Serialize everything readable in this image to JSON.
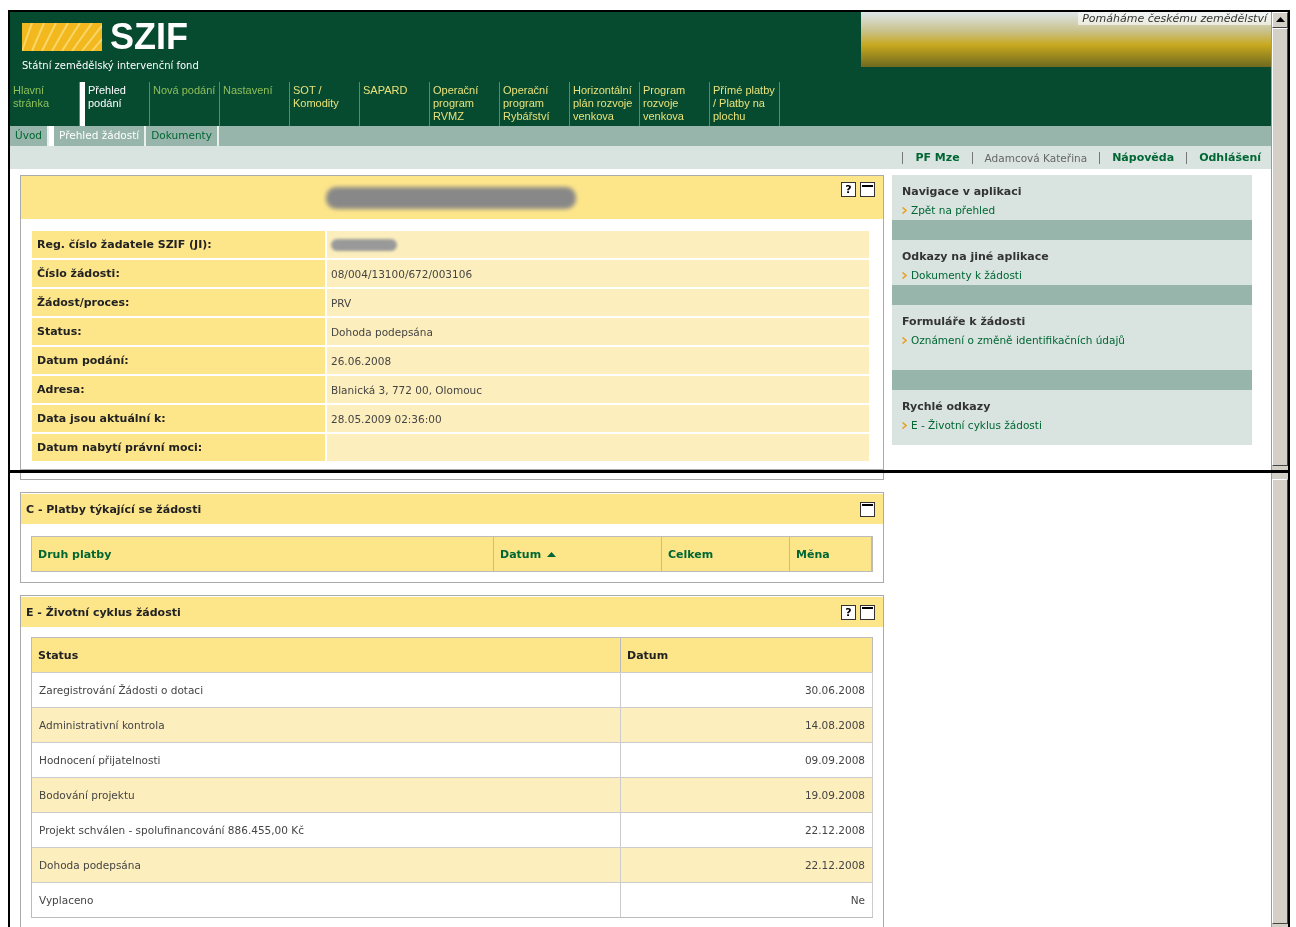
{
  "header": {
    "logo_text": "SZIF",
    "logo_subtitle": "Státní zemědělský intervenční fond",
    "banner_slogan": "Pomáháme českému zemědělství"
  },
  "main_nav": [
    {
      "label": "Hlavní stránka",
      "selected": false,
      "color": "#8fbf5a"
    },
    {
      "label": "Přehled podání",
      "selected": true,
      "color": "#ffffff"
    },
    {
      "label": "Nová podání",
      "selected": false,
      "color": "#8fbf5a"
    },
    {
      "label": "Nastavení",
      "selected": false,
      "color": "#8fbf5a"
    },
    {
      "label": "SOT / Komodity",
      "selected": false,
      "color": "#e8e27a"
    },
    {
      "label": "SAPARD",
      "selected": false,
      "color": "#e8e27a"
    },
    {
      "label": "Operační program RVMZ",
      "selected": false,
      "color": "#e8e27a"
    },
    {
      "label": "Operační program Rybářství",
      "selected": false,
      "color": "#e8e27a"
    },
    {
      "label": "Horizontální plán rozvoje venkova",
      "selected": false,
      "color": "#e8e27a"
    },
    {
      "label": "Program rozvoje venkova",
      "selected": false,
      "color": "#e8e27a"
    },
    {
      "label": "Přímé platby / Platby na plochu",
      "selected": false,
      "color": "#e8e27a"
    }
  ],
  "sub_nav": [
    {
      "label": "Úvod",
      "selected": false
    },
    {
      "label": "Přehled žádostí",
      "selected": true
    },
    {
      "label": "Dokumenty",
      "selected": false
    }
  ],
  "user_bar": [
    {
      "label": "PF Mze",
      "kind": "link"
    },
    {
      "label": "Adamcová Kateřina",
      "kind": "text"
    },
    {
      "label": "Nápověda",
      "kind": "link"
    },
    {
      "label": "Odhlášení",
      "kind": "link"
    }
  ],
  "detail_panel": {
    "help_button": "?",
    "rows": [
      {
        "label": "Reg. číslo žadatele SZIF (JI):",
        "value": null,
        "redacted": true
      },
      {
        "label": "Číslo žádosti:",
        "value": "08/004/13100/672/003106",
        "redacted": false
      },
      {
        "label": "Žádost/proces:",
        "value": "PRV",
        "redacted": false
      },
      {
        "label": "Status:",
        "value": "Dohoda podepsána",
        "redacted": false
      },
      {
        "label": "Datum podání:",
        "value": "26.06.2008",
        "redacted": false
      },
      {
        "label": "Adresa:",
        "value": "Blanická 3, 772 00, Olomouc",
        "redacted": false
      },
      {
        "label": "Data jsou aktuální k:",
        "value": "28.05.2009 02:36:00",
        "redacted": false
      },
      {
        "label": "Datum nabytí právní moci:",
        "value": null,
        "redacted": false
      }
    ]
  },
  "sidebar": [
    {
      "heading": "Navigace v aplikaci",
      "links": [
        "Zpět na přehled"
      ]
    },
    {
      "heading": "Odkazy na jiné aplikace",
      "links": [
        "Dokumenty k žádosti"
      ]
    },
    {
      "heading": "Formuláře k žádosti",
      "links": [
        "Oznámení o změně identifikačních údajů"
      ]
    },
    {
      "heading": "Rychlé odkazy",
      "links": [
        "E - Životní cyklus žádosti"
      ]
    }
  ],
  "payments_panel": {
    "title": "C - Platby týkající se žádosti",
    "columns": [
      {
        "label": "Druh platby",
        "sorted": false
      },
      {
        "label": "Datum",
        "sorted": true
      },
      {
        "label": "Celkem",
        "sorted": false
      },
      {
        "label": "Měna",
        "sorted": false
      }
    ]
  },
  "lifecycle_panel": {
    "title": "E - Životní cyklus žádosti",
    "help_button": "?",
    "columns": [
      "Status",
      "Datum"
    ],
    "rows": [
      [
        "Zaregistrování Žádosti o dotaci",
        "30.06.2008"
      ],
      [
        "Administrativní kontrola",
        "14.08.2008"
      ],
      [
        "Hodnocení přijatelnosti",
        "09.09.2008"
      ],
      [
        "Bodování projektu",
        "19.09.2008"
      ],
      [
        "Projekt schválen - spolufinancování 886.455,00 Kč",
        "22.12.2008"
      ],
      [
        "Dohoda podepsána",
        "22.12.2008"
      ],
      [
        "Vyplaceno",
        "Ne"
      ]
    ]
  }
}
